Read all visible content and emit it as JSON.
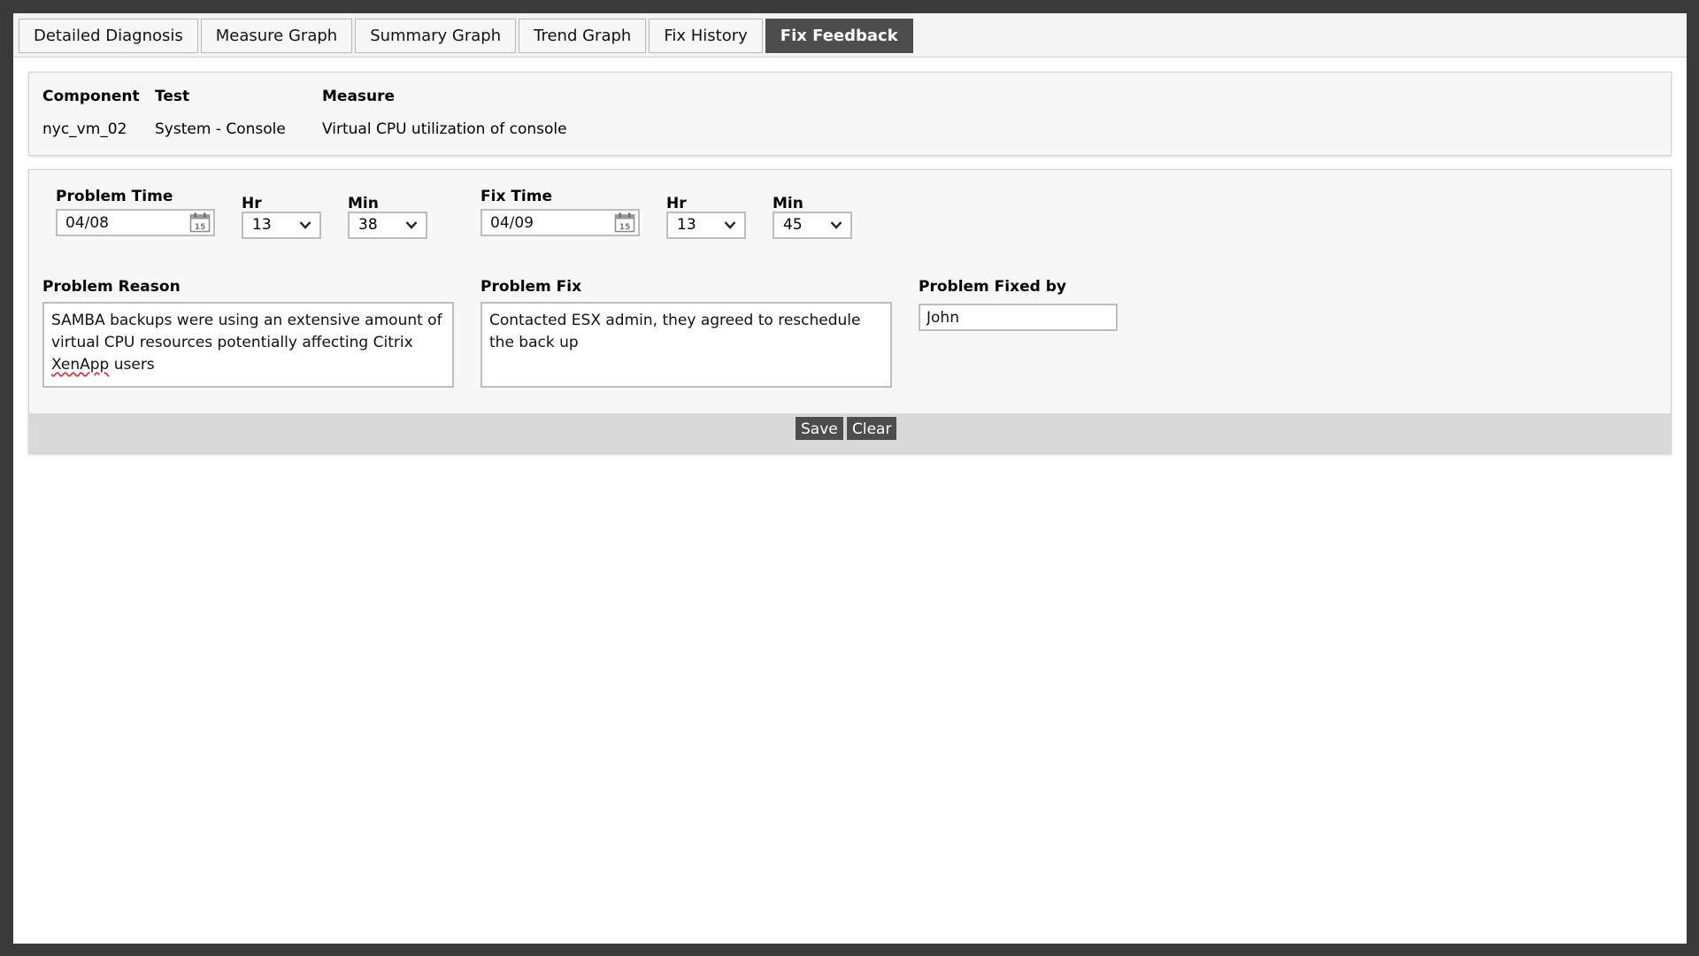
{
  "tabs": [
    {
      "label": "Detailed Diagnosis"
    },
    {
      "label": "Measure Graph"
    },
    {
      "label": "Summary Graph"
    },
    {
      "label": "Trend Graph"
    },
    {
      "label": "Fix History"
    },
    {
      "label": "Fix Feedback"
    }
  ],
  "active_tab": "Fix Feedback",
  "info": {
    "component_label": "Component",
    "component_value": "nyc_vm_02",
    "test_label": "Test",
    "test_value": "System - Console",
    "measure_label": "Measure",
    "measure_value": "Virtual CPU utilization of console"
  },
  "form": {
    "problem_time": {
      "label": "Problem Time",
      "date": "04/08",
      "hr_label": "Hr",
      "hr": "13",
      "min_label": "Min",
      "min": "38"
    },
    "fix_time": {
      "label": "Fix Time",
      "date": "04/09",
      "hr_label": "Hr",
      "hr": "13",
      "min_label": "Min",
      "min": "45"
    },
    "problem_reason": {
      "label": "Problem Reason",
      "text_before": "SAMBA backups were using an extensive amount of virtual CPU resources potentially affecting Citrix ",
      "text_flagged": "XenApp",
      "text_after": " users"
    },
    "problem_fix": {
      "label": "Problem Fix",
      "text": "Contacted ESX admin, they agreed to reschedule the back up"
    },
    "problem_fixed_by": {
      "label": "Problem Fixed by",
      "value": "John"
    }
  },
  "actions": {
    "save_label": "Save",
    "clear_label": "Clear"
  },
  "icons": {
    "calendar_day": "15"
  },
  "colors": {
    "active_tab_bg": "#4d4d4d",
    "button_bg": "#4d4d4d",
    "action_bar_bg": "#d9d9d9",
    "panel_bg": "#f7f7f7",
    "outer_frame": "#3a3a3a"
  }
}
